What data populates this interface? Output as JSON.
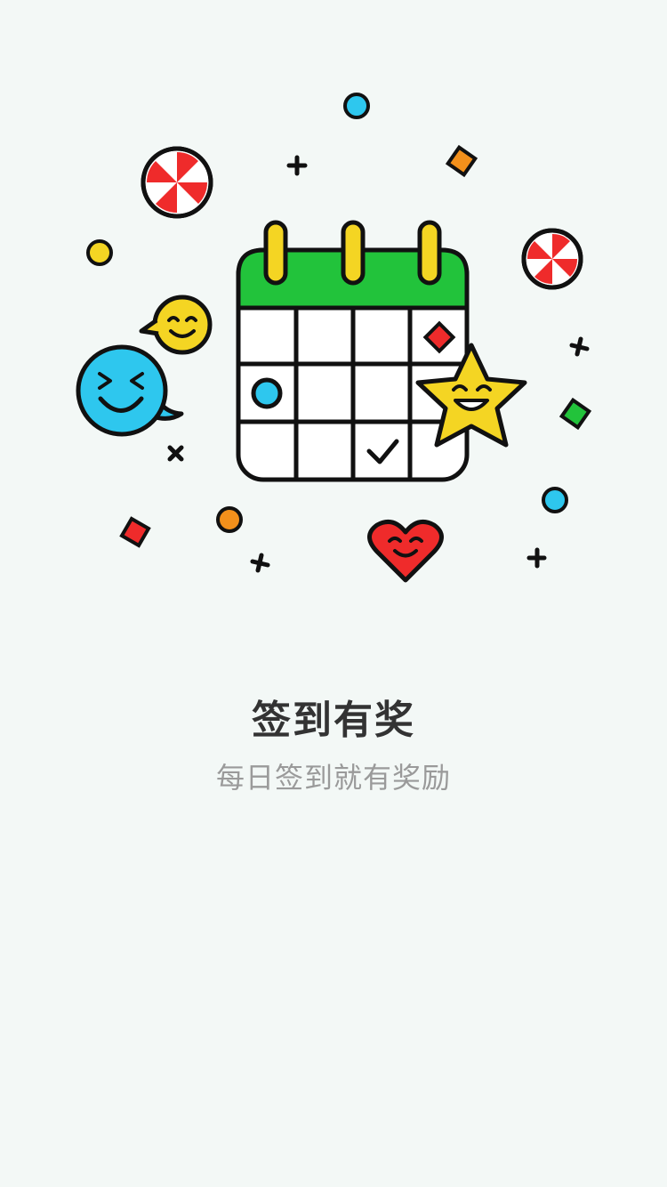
{
  "screen": {
    "title": "签到有奖",
    "subtitle": "每日签到就有奖励"
  },
  "illustration": {
    "icons": [
      "calendar-icon",
      "checkmark-icon",
      "star-face-icon",
      "smiley-bubble-icon",
      "heart-face-icon",
      "peppermint-candy-icon",
      "confetti-dot-icon",
      "confetti-diamond-icon",
      "confetti-cross-icon"
    ],
    "colors": {
      "background": "#f3f8f6",
      "outline": "#111111",
      "calendar_header": "#22c33b",
      "rings": "#f4d523",
      "blue": "#2ec7ee",
      "yellow": "#f4d523",
      "red": "#ef2b2b",
      "orange": "#f3901b",
      "green": "#22c33b",
      "title": "#333333",
      "subtitle": "#9a9a9a"
    }
  }
}
